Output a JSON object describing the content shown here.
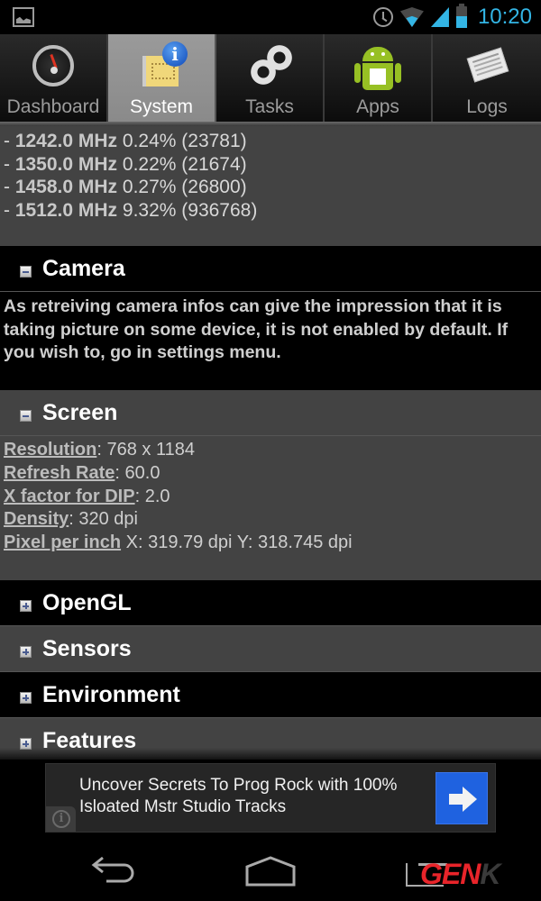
{
  "status_bar": {
    "time": "10:20",
    "icons": [
      "gallery-icon",
      "alarm-icon",
      "wifi-icon",
      "signal-icon",
      "battery-icon"
    ],
    "accent_color": "#33b5e5"
  },
  "tabs": [
    {
      "label": "Dashboard",
      "icon": "gauge-icon",
      "selected": false
    },
    {
      "label": "System",
      "icon": "system-info-icon",
      "selected": true
    },
    {
      "label": "Tasks",
      "icon": "gears-icon",
      "selected": false
    },
    {
      "label": "Apps",
      "icon": "android-icon",
      "selected": false
    },
    {
      "label": "Logs",
      "icon": "newspaper-icon",
      "selected": false
    }
  ],
  "cpu_frequencies": [
    {
      "prefix": "- ",
      "freq": "1242.0 MHz",
      "stat": " 0.24% (23781)"
    },
    {
      "prefix": "- ",
      "freq": "1350.0 MHz",
      "stat": " 0.22% (21674)"
    },
    {
      "prefix": "- ",
      "freq": "1458.0 MHz",
      "stat": " 0.27% (26800)"
    },
    {
      "prefix": "- ",
      "freq": "1512.0 MHz",
      "stat": " 9.32% (936768)"
    }
  ],
  "sections": {
    "camera": {
      "title": "Camera",
      "expanded": true,
      "body": "As retreiving camera infos can give the impression that it is taking picture on some device, it is not enabled by default. If you wish to, go in settings menu."
    },
    "screen": {
      "title": "Screen",
      "expanded": true,
      "rows": [
        {
          "key": "Resolution",
          "sep": ": ",
          "value": "768 x 1184"
        },
        {
          "key": "Refresh Rate",
          "sep": ": ",
          "value": "60.0"
        },
        {
          "key": "X factor for DIP",
          "sep": ": ",
          "value": "2.0"
        },
        {
          "key": "Density",
          "sep": ": ",
          "value": "320 dpi"
        },
        {
          "key": "Pixel per inch",
          "sep": " ",
          "value": "X: 319.79 dpi Y: 318.745 dpi"
        }
      ]
    },
    "collapsed": [
      {
        "title": "OpenGL",
        "expanded": false
      },
      {
        "title": "Sensors",
        "expanded": false
      },
      {
        "title": "Environment",
        "expanded": false
      },
      {
        "title": "Features",
        "expanded": false
      }
    ]
  },
  "ad": {
    "line1": "Uncover Secrets To Prog Rock with 100%",
    "line2": "Isloated Mstr Studio Tracks",
    "info_glyph": "i",
    "button_color": "#1f62e0"
  },
  "navbar": {
    "buttons": [
      "back",
      "home",
      "recent-apps"
    ]
  },
  "watermark": {
    "text": "GEN",
    "tail": "K"
  }
}
